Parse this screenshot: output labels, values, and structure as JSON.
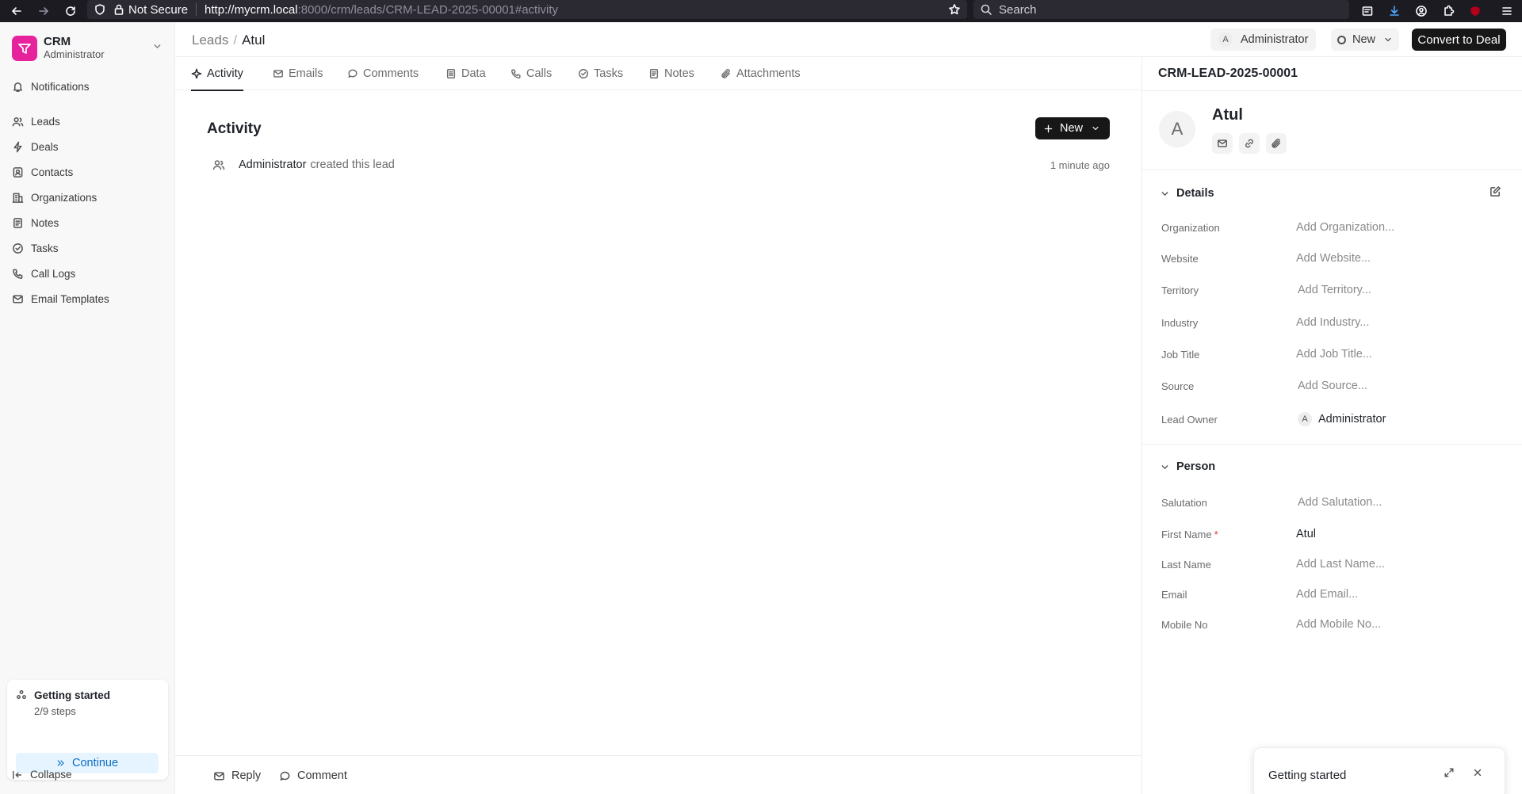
{
  "browser": {
    "security": "Not Secure",
    "url_host": "http://mycrm.local",
    "url_rest": ":8000/crm/leads/CRM-LEAD-2025-00001#activity",
    "search_placeholder": "Search"
  },
  "sidebar": {
    "brand_title": "CRM",
    "brand_sub": "Administrator",
    "items": [
      {
        "label": "Notifications",
        "icon": "bell-icon"
      },
      {
        "label": "Leads",
        "icon": "users-icon"
      },
      {
        "label": "Deals",
        "icon": "bolt-icon"
      },
      {
        "label": "Contacts",
        "icon": "contact-icon"
      },
      {
        "label": "Organizations",
        "icon": "building-icon"
      },
      {
        "label": "Notes",
        "icon": "note-icon"
      },
      {
        "label": "Tasks",
        "icon": "check-circle-icon"
      },
      {
        "label": "Call Logs",
        "icon": "phone-icon"
      },
      {
        "label": "Email Templates",
        "icon": "mail-icon"
      }
    ],
    "getting_started": {
      "title": "Getting started",
      "steps": "2/9 steps",
      "continue": "Continue"
    },
    "collapse": "Collapse"
  },
  "header": {
    "crumb_parent": "Leads",
    "crumb_sep": "/",
    "crumb_current": "Atul",
    "assignee_initial": "A",
    "assignee": "Administrator",
    "status": "New",
    "convert": "Convert to Deal"
  },
  "tabs": [
    {
      "label": "Activity",
      "icon": "activity-icon"
    },
    {
      "label": "Emails",
      "icon": "mail-icon"
    },
    {
      "label": "Comments",
      "icon": "comment-icon"
    },
    {
      "label": "Data",
      "icon": "document-icon"
    },
    {
      "label": "Calls",
      "icon": "phone-icon"
    },
    {
      "label": "Tasks",
      "icon": "check-circle-icon"
    },
    {
      "label": "Notes",
      "icon": "note-icon"
    },
    {
      "label": "Attachments",
      "icon": "paperclip-icon"
    }
  ],
  "activity": {
    "title": "Activity",
    "new_button": "New",
    "entries": [
      {
        "actor": "Administrator",
        "text": "created this lead",
        "time": "1 minute ago"
      }
    ]
  },
  "bottom": {
    "reply": "Reply",
    "comment": "Comment"
  },
  "lead": {
    "id": "CRM-LEAD-2025-00001",
    "avatar_initial": "A",
    "name": "Atul",
    "details_title": "Details",
    "details": [
      {
        "label": "Organization",
        "value": "Add Organization..."
      },
      {
        "label": "Website",
        "value": "Add Website..."
      },
      {
        "label": "Territory",
        "value": "Add Territory..."
      },
      {
        "label": "Industry",
        "value": "Add Industry..."
      },
      {
        "label": "Job Title",
        "value": "Add Job Title..."
      },
      {
        "label": "Source",
        "value": "Add Source..."
      },
      {
        "label": "Lead Owner",
        "value": "Administrator",
        "initial": "A"
      }
    ],
    "person_title": "Person",
    "person": [
      {
        "label": "Salutation",
        "value": "Add Salutation..."
      },
      {
        "label": "First Name",
        "value": "Atul",
        "required": "*"
      },
      {
        "label": "Last Name",
        "value": "Add Last Name..."
      },
      {
        "label": "Email",
        "value": "Add Email..."
      },
      {
        "label": "Mobile No",
        "value": "Add Mobile No..."
      }
    ]
  },
  "getting_started_panel": {
    "title": "Getting started"
  }
}
